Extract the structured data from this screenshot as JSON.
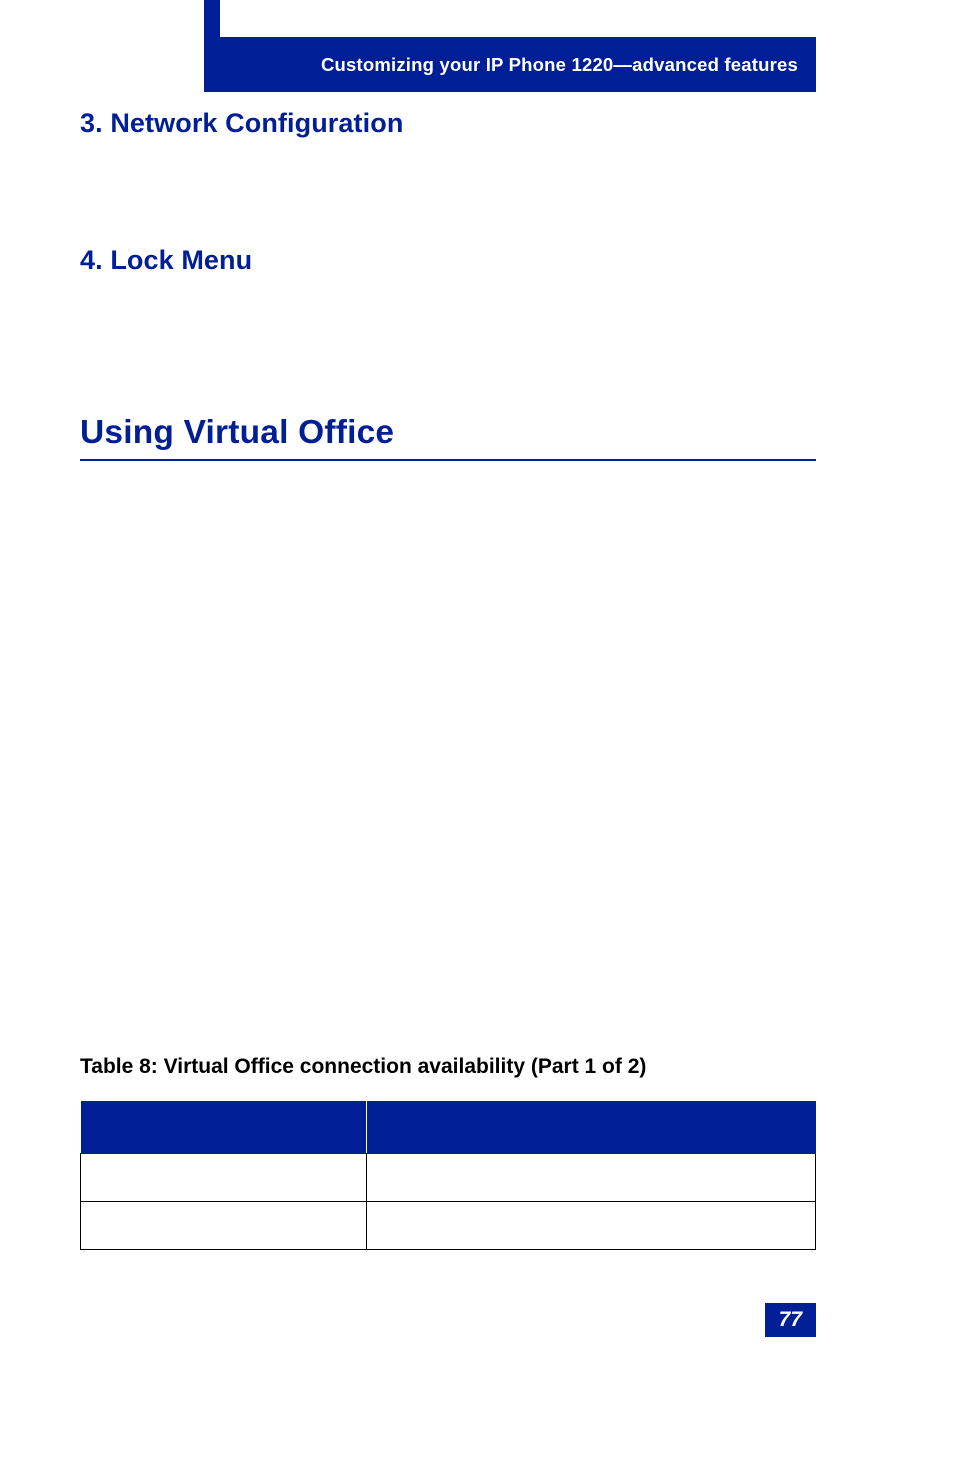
{
  "header": {
    "running_title": "Customizing your IP Phone 1220—advanced features"
  },
  "sections": {
    "h3_a": "3. Network Configuration",
    "h3_b": "4. Lock Menu",
    "h2": "Using Virtual Office"
  },
  "table": {
    "caption": "Table 8: Virtual Office connection availability (Part 1 of 2)"
  },
  "page_number": "77"
}
